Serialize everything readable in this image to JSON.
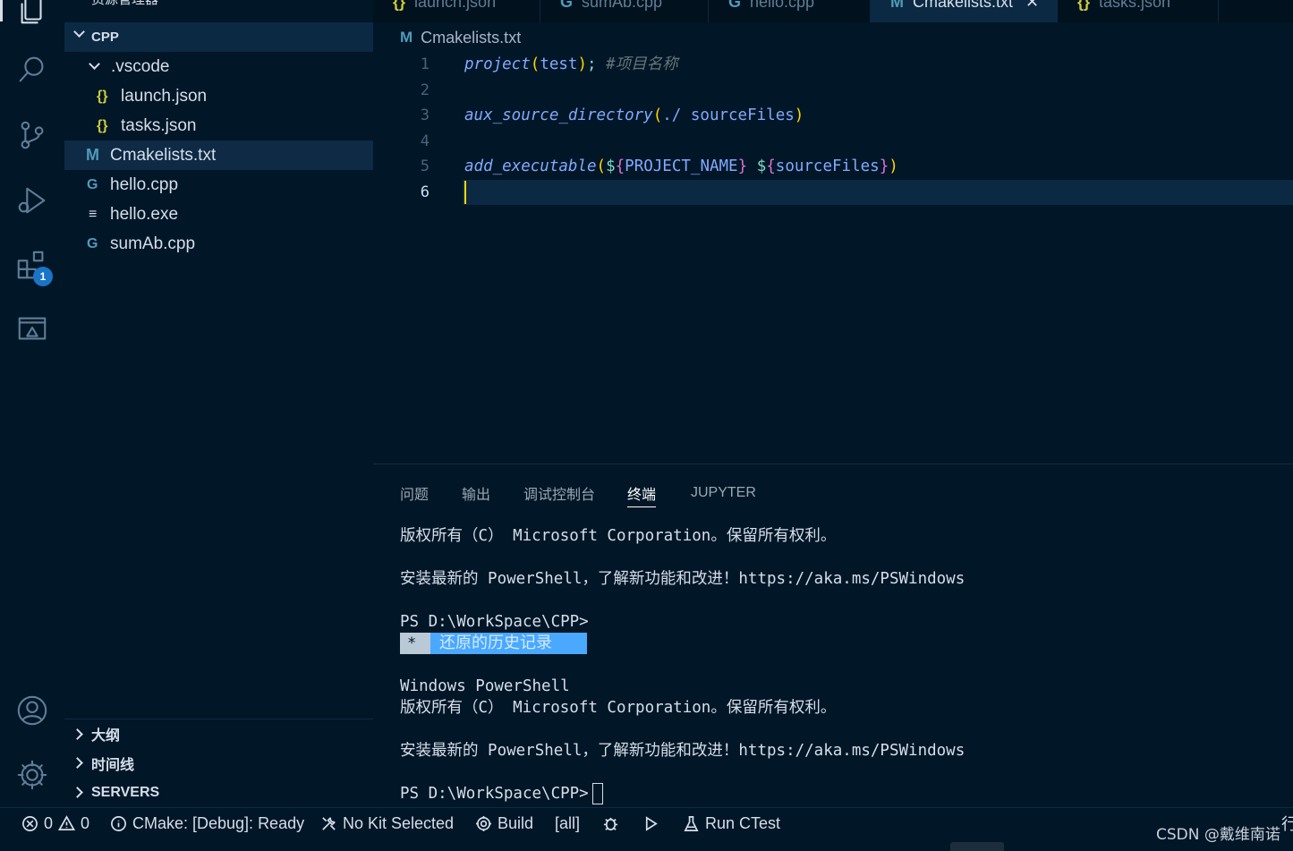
{
  "sidebar": {
    "header": "资源管理器",
    "section_title": "CPP",
    "tree": [
      {
        "label": ".vscode",
        "icon": "chevron-down-icon",
        "glyph": ""
      },
      {
        "label": "launch.json",
        "icon": "json-file-icon",
        "glyph": "{}"
      },
      {
        "label": "tasks.json",
        "icon": "json-file-icon",
        "glyph": "{}"
      },
      {
        "label": "Cmakelists.txt",
        "icon": "cmake-file-icon",
        "glyph": "M"
      },
      {
        "label": "hello.cpp",
        "icon": "cpp-file-icon",
        "glyph": "G"
      },
      {
        "label": "hello.exe",
        "icon": "exe-file-icon",
        "glyph": "≡"
      },
      {
        "label": "sumAb.cpp",
        "icon": "cpp-file-icon",
        "glyph": "G"
      }
    ],
    "bottom_sections": [
      "大纲",
      "时间线",
      "SERVERS"
    ]
  },
  "activity": {
    "extensions_badge": "1"
  },
  "tabs": [
    {
      "label": "launch.json",
      "glyph": "{}"
    },
    {
      "label": "sumAb.cpp",
      "glyph": "G"
    },
    {
      "label": "hello.cpp",
      "glyph": "G"
    },
    {
      "label": "Cmakelists.txt",
      "glyph": "M"
    },
    {
      "label": "tasks.json",
      "glyph": "{}"
    }
  ],
  "tab_close_glyph": "✕",
  "breadcrumb": {
    "glyph": "M",
    "label": "Cmakelists.txt"
  },
  "editor": {
    "line_numbers": [
      "1",
      "2",
      "3",
      "4",
      "5",
      "6"
    ],
    "lines": {
      "l1": {
        "fn": "project",
        "open": "(",
        "arg": "test",
        "close": ")",
        "semi": ";",
        "comment": " #项目名称"
      },
      "l3": {
        "fn": "aux_source_directory",
        "open": "(",
        "arg": "./ sourceFiles",
        "close": ")"
      },
      "l5": {
        "fn": "add_executable",
        "open": "(",
        "d1": "$",
        "b1o": "{",
        "v1": "PROJECT_NAME",
        "b1c": "}",
        "sp": " ",
        "d2": "$",
        "b2o": "{",
        "v2": "sourceFiles",
        "b2c": "}",
        "close": ")"
      }
    }
  },
  "panel": {
    "tabs": [
      "问题",
      "输出",
      "调试控制台",
      "终端",
      "JUPYTER"
    ],
    "active_tab": "终端",
    "terminal": {
      "line1": "版权所有（C） Microsoft Corporation。保留所有权利。",
      "line2": "安装最新的 PowerShell，了解新功能和改进！https://aka.ms/PSWindows",
      "prompt1": "PS D:\\WorkSpace\\CPP>",
      "restore_star": "*",
      "restore_text": "还原的历史记录",
      "line3": "Windows PowerShell",
      "line4": "版权所有（C） Microsoft Corporation。保留所有权利。",
      "line5": "安装最新的 PowerShell，了解新功能和改进！https://aka.ms/PSWindows",
      "prompt2": "PS D:\\WorkSpace\\CPP>"
    }
  },
  "statusbar": {
    "errors": "0",
    "warnings": "0",
    "cmake_status": "CMake: [Debug]: Ready",
    "kit": "No Kit Selected",
    "build": "Build",
    "target": "[all]",
    "run_ctest": "Run CTest",
    "overflow_char": "行"
  },
  "watermark": "CSDN @戴维南诺"
}
